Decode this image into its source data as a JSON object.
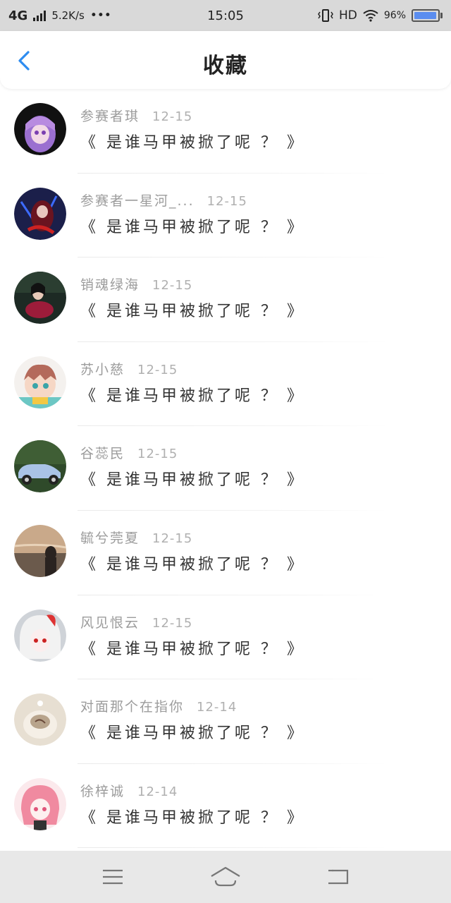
{
  "status_bar": {
    "network": "4G",
    "speed": "5.2K/s",
    "more_icon": "•••",
    "time": "15:05",
    "hd": "HD",
    "battery_text": "96%",
    "battery_level": 0.96
  },
  "header": {
    "back_icon": "chevron-left-icon",
    "title": "收藏",
    "accent_color": "#2d8cf0"
  },
  "items": [
    {
      "name": "参赛者琪",
      "date": "12-15",
      "title": "《 是谁马甲被掀了呢 ？ 》",
      "avatar": "purple-hair-girl"
    },
    {
      "name": "参赛者一星河_...",
      "date": "12-15",
      "title": "《 是谁马甲被掀了呢 ？ 》",
      "avatar": "dark-red-character"
    },
    {
      "name": "销魂绿海",
      "date": "12-15",
      "title": "《 是谁马甲被掀了呢 ？ 》",
      "avatar": "girl-sitting"
    },
    {
      "name": "苏小慈",
      "date": "12-15",
      "title": "《 是谁马甲被掀了呢 ？ 》",
      "avatar": "chibi-character"
    },
    {
      "name": "谷蕊民",
      "date": "12-15",
      "title": "《 是谁马甲被掀了呢 ？ 》",
      "avatar": "blue-vintage-car"
    },
    {
      "name": "毓兮莞夏",
      "date": "12-15",
      "title": "《 是谁马甲被掀了呢 ？ 》",
      "avatar": "sunset-silhouette"
    },
    {
      "name": "风见恨云",
      "date": "12-15",
      "title": "《 是谁马甲被掀了呢 ？ 》",
      "avatar": "white-hair-anime"
    },
    {
      "name": "对面那个在指你",
      "date": "12-14",
      "title": "《 是谁马甲被掀了呢 ？ 》",
      "avatar": "cup-closeup"
    },
    {
      "name": "徐梓诚",
      "date": "12-14",
      "title": "《 是谁马甲被掀了呢 ？ 》",
      "avatar": "pink-hair-girl"
    }
  ],
  "nav": {
    "menu_icon": "menu-icon",
    "home_icon": "home-icon",
    "back_icon": "return-icon"
  }
}
